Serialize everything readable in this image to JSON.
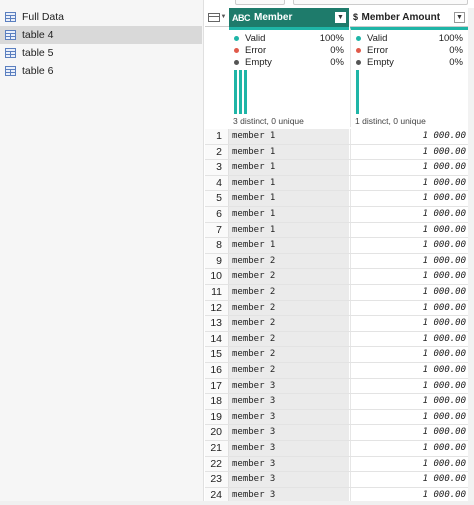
{
  "queries": [
    {
      "label": "Full Data",
      "selected": false
    },
    {
      "label": "table 4",
      "selected": true
    },
    {
      "label": "table 5",
      "selected": false
    },
    {
      "label": "table 6",
      "selected": false
    }
  ],
  "columns": [
    {
      "name": "Member",
      "type_icon": "ABC",
      "stats": {
        "valid": "100%",
        "error": "0%",
        "empty": "0%"
      },
      "distinct": "3 distinct, 0 unique",
      "distribution": [
        1.0,
        1.0,
        1.0
      ]
    },
    {
      "name": "Member Amount",
      "type_icon": "$",
      "stats": {
        "valid": "100%",
        "error": "0%",
        "empty": "0%"
      },
      "distinct": "1 distinct, 0 unique",
      "distribution": [
        1.0
      ]
    }
  ],
  "stat_labels": {
    "valid": "Valid",
    "error": "Error",
    "empty": "Empty"
  },
  "colors": {
    "header_accent": "#1e7b6b",
    "quality_bar": "#1fb5a7",
    "valid_dot": "#1fb5a7",
    "error_dot": "#e05a4a",
    "empty_dot": "#555555"
  },
  "rows": [
    {
      "n": "1",
      "member": "member 1",
      "amount": "1 000.00"
    },
    {
      "n": "2",
      "member": "member 1",
      "amount": "1 000.00"
    },
    {
      "n": "3",
      "member": "member 1",
      "amount": "1 000.00"
    },
    {
      "n": "4",
      "member": "member 1",
      "amount": "1 000.00"
    },
    {
      "n": "5",
      "member": "member 1",
      "amount": "1 000.00"
    },
    {
      "n": "6",
      "member": "member 1",
      "amount": "1 000.00"
    },
    {
      "n": "7",
      "member": "member 1",
      "amount": "1 000.00"
    },
    {
      "n": "8",
      "member": "member 1",
      "amount": "1 000.00"
    },
    {
      "n": "9",
      "member": "member 2",
      "amount": "1 000.00"
    },
    {
      "n": "10",
      "member": "member 2",
      "amount": "1 000.00"
    },
    {
      "n": "11",
      "member": "member 2",
      "amount": "1 000.00"
    },
    {
      "n": "12",
      "member": "member 2",
      "amount": "1 000.00"
    },
    {
      "n": "13",
      "member": "member 2",
      "amount": "1 000.00"
    },
    {
      "n": "14",
      "member": "member 2",
      "amount": "1 000.00"
    },
    {
      "n": "15",
      "member": "member 2",
      "amount": "1 000.00"
    },
    {
      "n": "16",
      "member": "member 2",
      "amount": "1 000.00"
    },
    {
      "n": "17",
      "member": "member 3",
      "amount": "1 000.00"
    },
    {
      "n": "18",
      "member": "member 3",
      "amount": "1 000.00"
    },
    {
      "n": "19",
      "member": "member 3",
      "amount": "1 000.00"
    },
    {
      "n": "20",
      "member": "member 3",
      "amount": "1 000.00"
    },
    {
      "n": "21",
      "member": "member 3",
      "amount": "1 000.00"
    },
    {
      "n": "22",
      "member": "member 3",
      "amount": "1 000.00"
    },
    {
      "n": "23",
      "member": "member 3",
      "amount": "1 000.00"
    },
    {
      "n": "24",
      "member": "member 3",
      "amount": "1 000.00"
    }
  ]
}
